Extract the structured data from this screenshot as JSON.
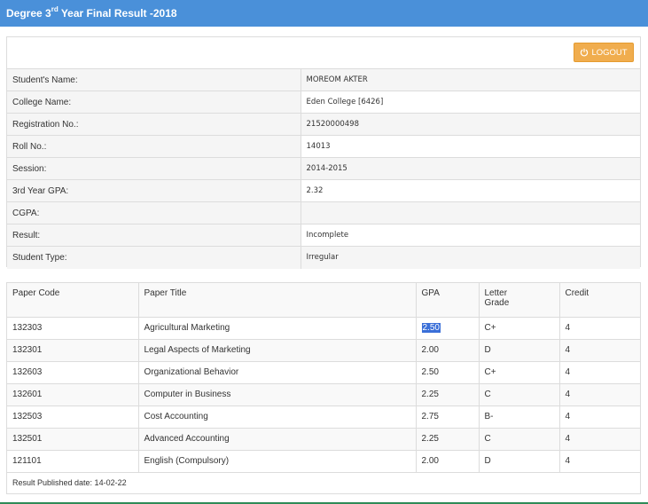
{
  "header": {
    "title_prefix": "Degree 3",
    "title_sup": "rd",
    "title_suffix": " Year Final Result -2018"
  },
  "logout": {
    "icon": "power-icon",
    "label": "LOGOUT"
  },
  "student_info": [
    {
      "label": "Student's Name:",
      "value": "MOREOM AKTER"
    },
    {
      "label": "College Name:",
      "value": "Eden College [6426]"
    },
    {
      "label": "Registration No.:",
      "value": "21520000498"
    },
    {
      "label": "Roll No.:",
      "value": "14013"
    },
    {
      "label": "Session:",
      "value": "2014-2015"
    },
    {
      "label": "3rd Year GPA:",
      "value": "2.32"
    },
    {
      "label": "CGPA:",
      "value": ""
    },
    {
      "label": "Result:",
      "value": "Incomplete"
    },
    {
      "label": "Student Type:",
      "value": "Irregular"
    }
  ],
  "papers": {
    "headers": {
      "code": "Paper Code",
      "title": "Paper Title",
      "gpa": "GPA",
      "grade_line1": "Letter",
      "grade_line2": "Grade",
      "credit": "Credit"
    },
    "rows": [
      {
        "code": "132303",
        "title": "Agricultural Marketing",
        "gpa": "2.50",
        "grade": "C+",
        "credit": "4"
      },
      {
        "code": "132301",
        "title": "Legal Aspects of Marketing",
        "gpa": "2.00",
        "grade": "D",
        "credit": "4"
      },
      {
        "code": "132603",
        "title": "Organizational Behavior",
        "gpa": "2.50",
        "grade": "C+",
        "credit": "4"
      },
      {
        "code": "132601",
        "title": "Computer in Business",
        "gpa": "2.25",
        "grade": "C",
        "credit": "4"
      },
      {
        "code": "132503",
        "title": "Cost Accounting",
        "gpa": "2.75",
        "grade": "B-",
        "credit": "4"
      },
      {
        "code": "132501",
        "title": "Advanced Accounting",
        "gpa": "2.25",
        "grade": "C",
        "credit": "4"
      },
      {
        "code": "121101",
        "title": "English (Compulsory)",
        "gpa": "2.00",
        "grade": "D",
        "credit": "4"
      }
    ],
    "published": "Result Published date: 14-02-22"
  },
  "colors": {
    "header": "#4a90d9",
    "logout": "#f0ad4e",
    "selection": "#3a6fd8"
  }
}
